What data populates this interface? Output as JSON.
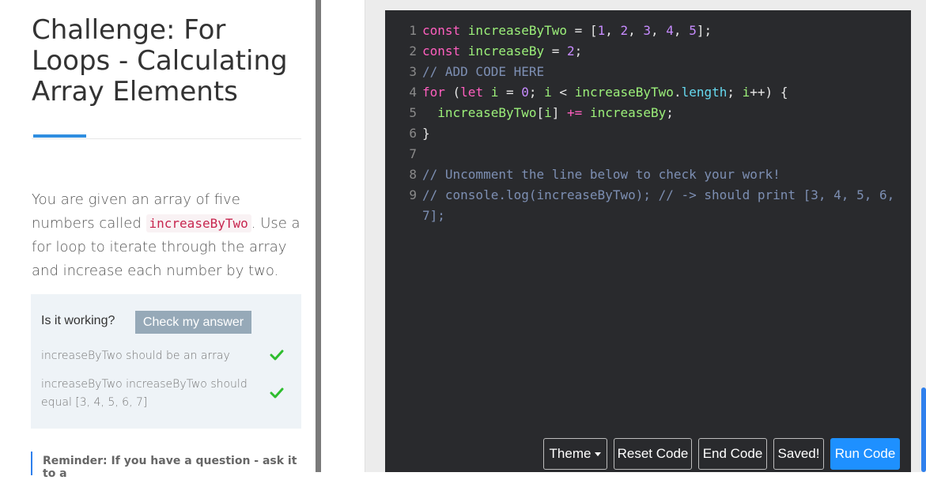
{
  "lesson": {
    "title": "Challenge: For Loops - Calculating Array Elements",
    "description_pre": "You are given an array of five numbers called ",
    "description_code": "increaseByTwo",
    "description_post": ". Use a for loop to iterate through the array and increase each number by two."
  },
  "checks": {
    "label": "Is it working?",
    "button_label": "Check my answer",
    "tests": [
      {
        "text": "increaseByTwo should be an array",
        "passed": true
      },
      {
        "text": "increaseByTwo increaseByTwo should equal [3, 4, 5, 6, 7]",
        "passed": true
      }
    ],
    "pass_color": "#2ebd2e"
  },
  "reminder": "Reminder: If you have a question - ask it to a",
  "editor": {
    "lines": [
      {
        "n": "1",
        "tokens": [
          [
            "kw",
            "const "
          ],
          [
            "vr",
            "increaseByTwo"
          ],
          [
            "pn",
            " = ["
          ],
          [
            "nm",
            "1"
          ],
          [
            "pn",
            ", "
          ],
          [
            "nm",
            "2"
          ],
          [
            "pn",
            ", "
          ],
          [
            "nm",
            "3"
          ],
          [
            "pn",
            ", "
          ],
          [
            "nm",
            "4"
          ],
          [
            "pn",
            ", "
          ],
          [
            "nm",
            "5"
          ],
          [
            "pn",
            "];"
          ]
        ]
      },
      {
        "n": "2",
        "tokens": [
          [
            "kw",
            "const "
          ],
          [
            "vr",
            "increaseBy"
          ],
          [
            "pn",
            " = "
          ],
          [
            "nm",
            "2"
          ],
          [
            "pn",
            ";"
          ]
        ]
      },
      {
        "n": "3",
        "tokens": [
          [
            "cm",
            "// ADD CODE HERE"
          ]
        ]
      },
      {
        "n": "4",
        "tokens": [
          [
            "kw",
            "for "
          ],
          [
            "pn",
            "("
          ],
          [
            "kw",
            "let "
          ],
          [
            "vr",
            "i"
          ],
          [
            "pn",
            " = "
          ],
          [
            "nm",
            "0"
          ],
          [
            "pn",
            "; "
          ],
          [
            "vr",
            "i"
          ],
          [
            "pn",
            " < "
          ],
          [
            "vr",
            "increaseByTwo"
          ],
          [
            "pn",
            "."
          ],
          [
            "pr",
            "length"
          ],
          [
            "pn",
            "; "
          ],
          [
            "vr",
            "i"
          ],
          [
            "pn",
            "++) {"
          ]
        ]
      },
      {
        "n": "5",
        "tokens": [
          [
            "pn",
            "  "
          ],
          [
            "vr",
            "increaseByTwo"
          ],
          [
            "pn",
            "["
          ],
          [
            "vr",
            "i"
          ],
          [
            "pn",
            "] "
          ],
          [
            "kw",
            "+="
          ],
          [
            "pn",
            " "
          ],
          [
            "vr",
            "increaseBy"
          ],
          [
            "pn",
            ";"
          ]
        ]
      },
      {
        "n": "6",
        "tokens": [
          [
            "pn",
            "}"
          ]
        ]
      },
      {
        "n": "7",
        "tokens": []
      },
      {
        "n": "8",
        "tokens": [
          [
            "cm",
            "// Uncomment the line below to check your work!"
          ]
        ]
      },
      {
        "n": "9",
        "tokens": [
          [
            "cm",
            "// console.log(increaseByTwo); // -> should print [3, 4, 5, 6,"
          ]
        ]
      },
      {
        "n": "",
        "tokens": [
          [
            "cm",
            "7];"
          ]
        ]
      }
    ]
  },
  "toolbar": {
    "theme_label": "Theme",
    "reset_label": "Reset Code",
    "end_label": "End Code",
    "saved_label": "Saved!",
    "run_label": "Run Code"
  }
}
